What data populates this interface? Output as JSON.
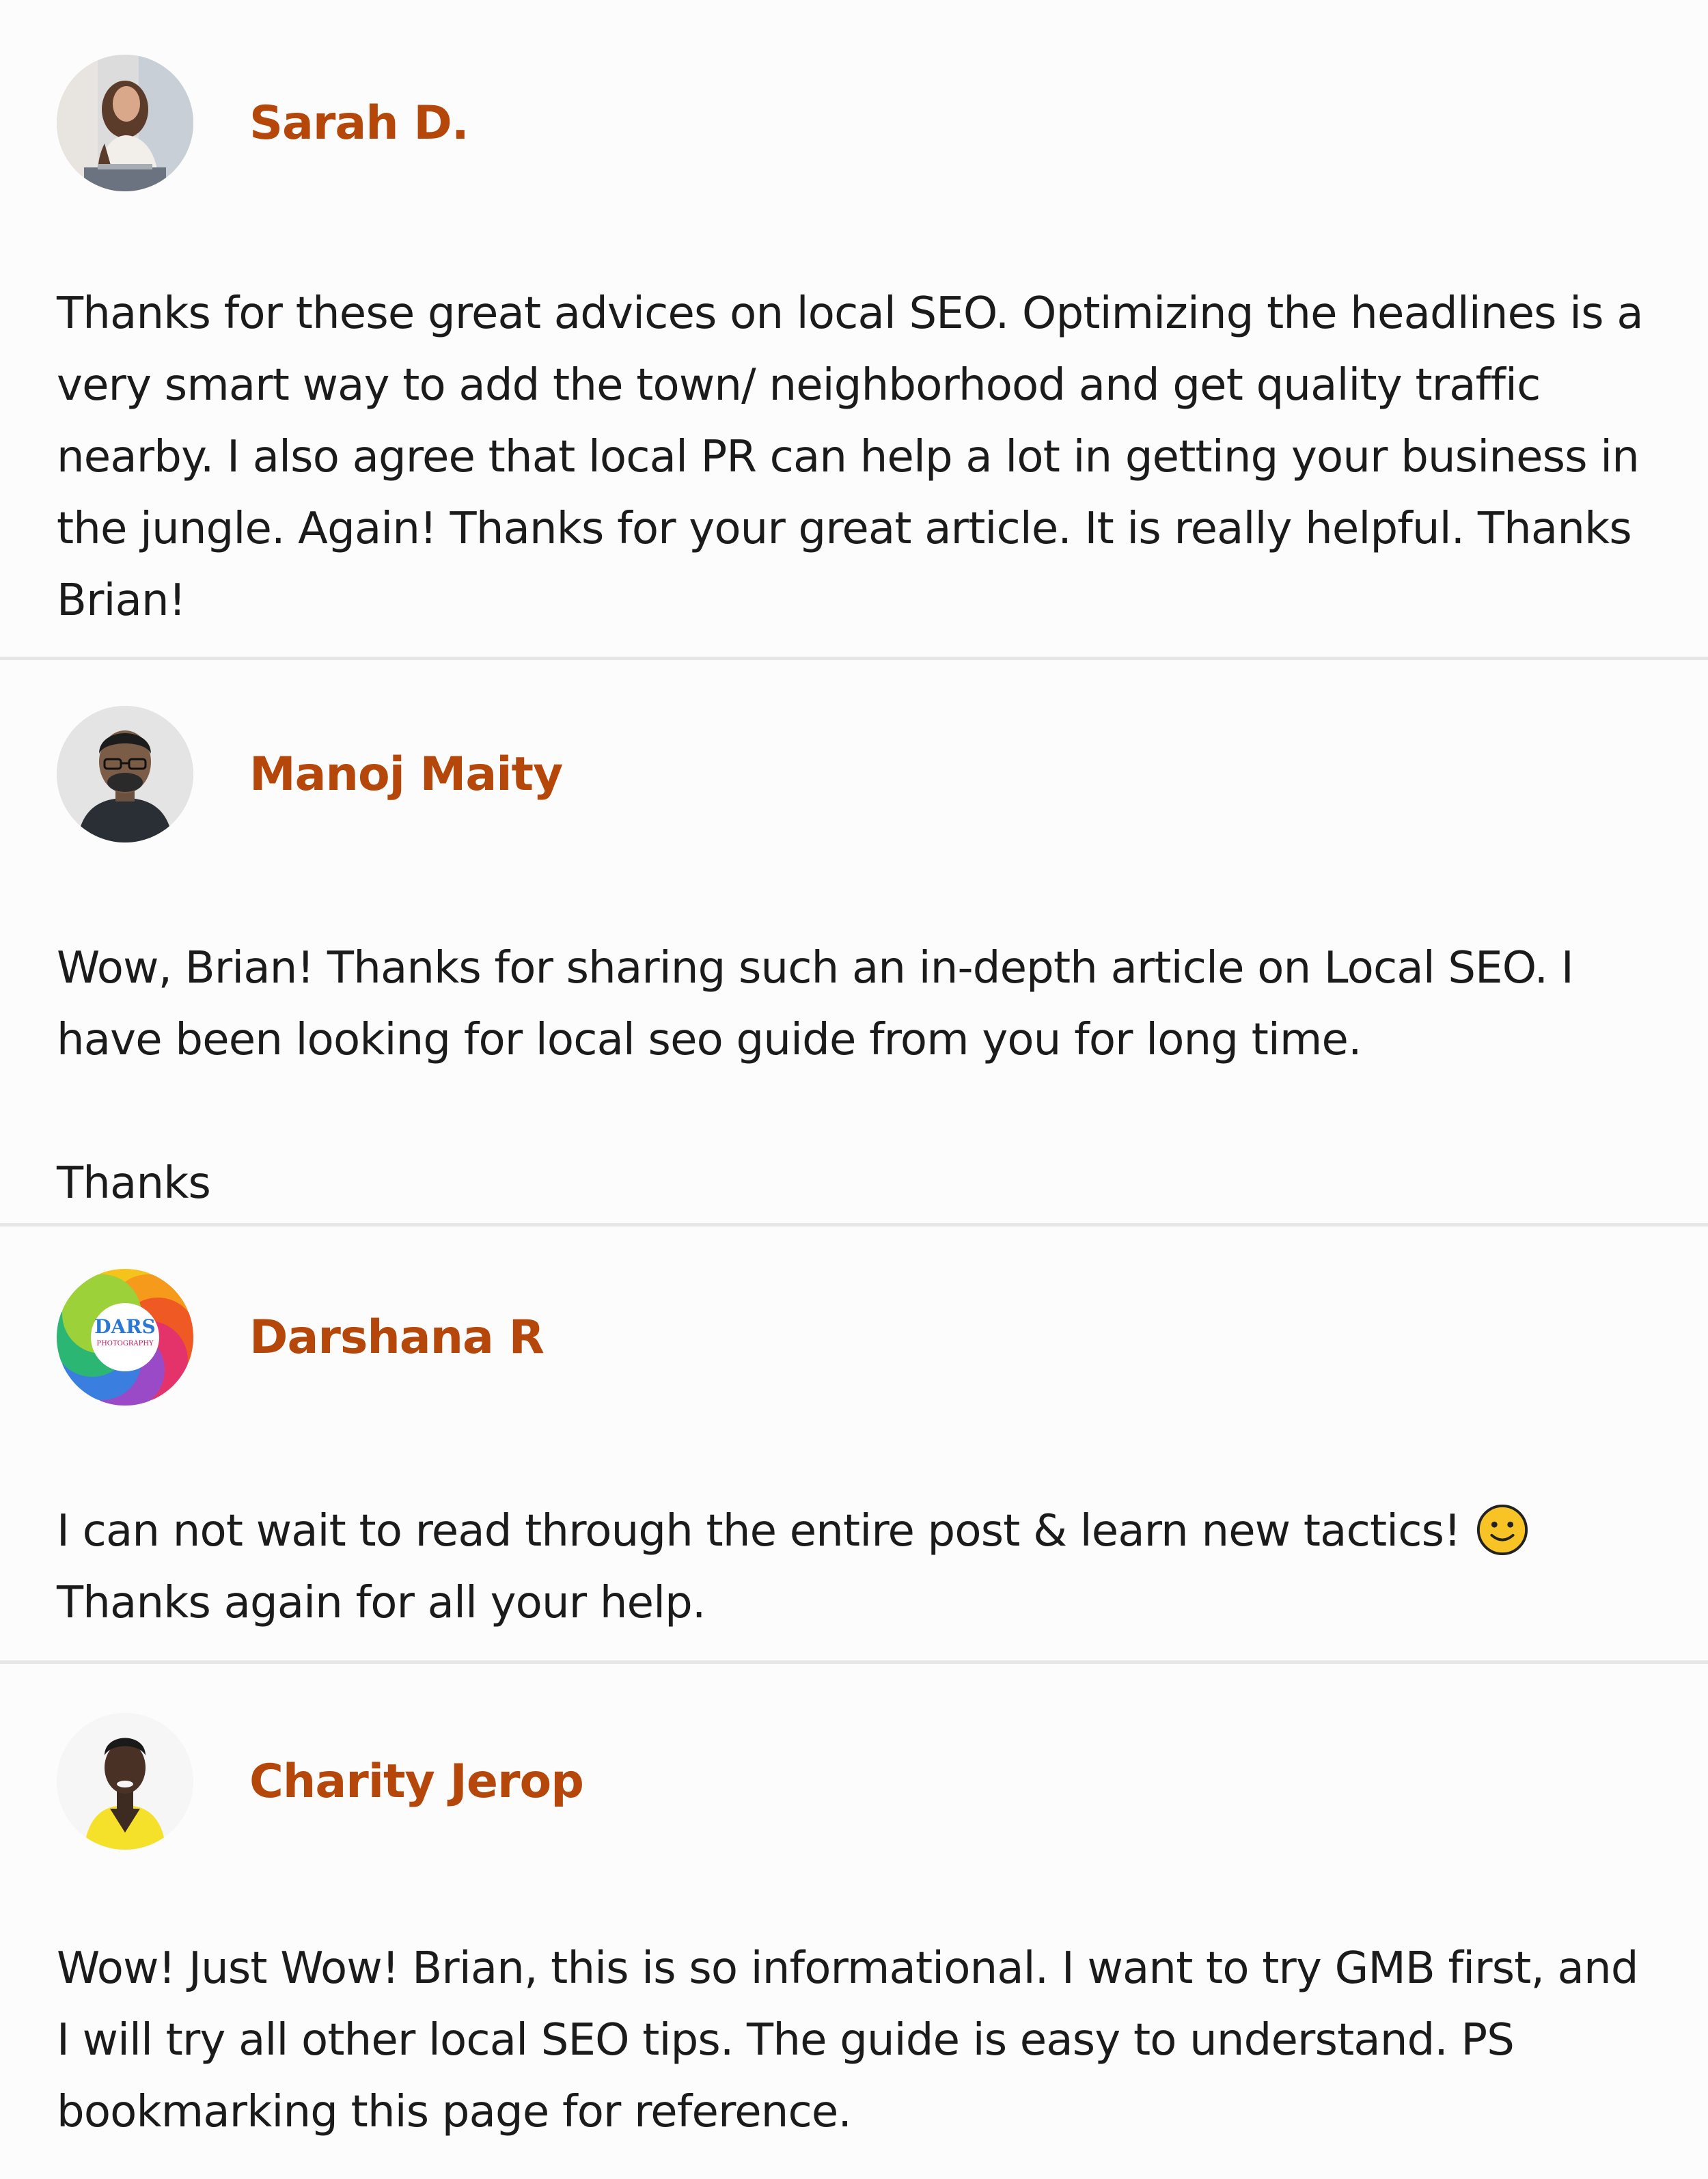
{
  "comments": [
    {
      "author": "Sarah D.",
      "avatar_icon": "woman-laptop-avatar",
      "text": "Thanks for these great advices on local SEO. Optimizing the headlines is a very smart way to add the town/ neighborhood and get quality traffic nearby. I also agree that local PR can help a lot in getting your business in the jungle. Again! Thanks for your great article. It is really helpful. Thanks Brian!"
    },
    {
      "author": "Manoj Maity",
      "avatar_icon": "man-portrait-avatar",
      "text": "Wow, Brian! Thanks for sharing such an in-depth article on Local SEO. I have been looking for local seo guide from you for long time.\n\nThanks"
    },
    {
      "author": "Darshana R",
      "avatar_icon": "colorful-flower-logo-avatar",
      "avatar_logo_text": "DARS",
      "avatar_logo_subtext": "PHOTOGRAPHY",
      "text": "I can not wait to read through the entire post & learn new tactics!",
      "text_after_emoji": "Thanks again for all your help.",
      "emoji": "smiley-face-icon"
    },
    {
      "author": "Charity Jerop",
      "avatar_icon": "woman-yellow-top-avatar",
      "text": "Wow! Just Wow! Brian, this is so informational. I want to try GMB first, and I will try all other local SEO tips. The guide is easy to understand. PS bookmarking this page for reference."
    }
  ],
  "colors": {
    "author": "#b5470a",
    "text": "#1b1b1b",
    "background": "#fcfcfc",
    "divider": "#e6e6e6",
    "emoji": "#f7c325"
  }
}
